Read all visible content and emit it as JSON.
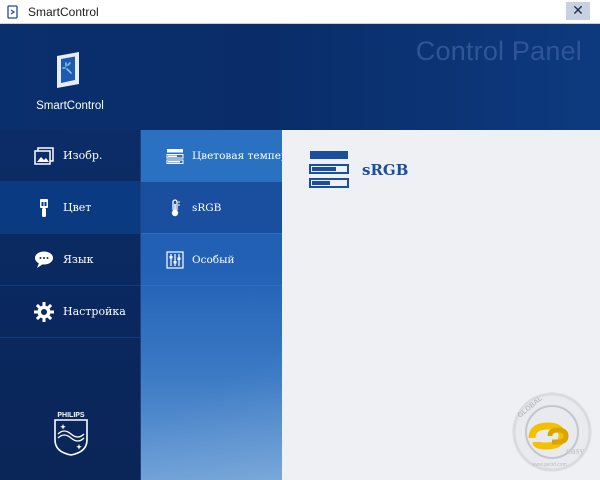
{
  "window": {
    "title": "SmartControl",
    "close_glyph": "✕"
  },
  "header": {
    "logo_title": "SmartControl",
    "panel_title": "Control Panel"
  },
  "main_menu": [
    {
      "label": "Изобр.",
      "icon": "image-icon"
    },
    {
      "label": "Цвет",
      "icon": "color-brush-icon",
      "active": true
    },
    {
      "label": "Язык",
      "icon": "language-bubble-icon"
    },
    {
      "label": "Настройка",
      "icon": "settings-gear-icon"
    }
  ],
  "sub_menu": [
    {
      "label": "Цветовая темпер",
      "icon": "color-temperature-icon"
    },
    {
      "label": "sRGB",
      "icon": "thermometer-icon",
      "active": true
    },
    {
      "label": "Особый",
      "icon": "sliders-icon"
    }
  ],
  "content": {
    "title": "sRGB",
    "icon": "srgb-bars-icon"
  },
  "brand": {
    "name": "PHILIPS"
  },
  "watermark": {
    "top": "GLOBAL",
    "bottom": "easy",
    "url": "www.gecid.com"
  },
  "colors": {
    "header_bg": "#0a2d69",
    "active_main": "#0a3a82",
    "sub_column": "#2361b7",
    "content_bg": "#eef0f3",
    "accent_text": "#1a4e9e"
  }
}
